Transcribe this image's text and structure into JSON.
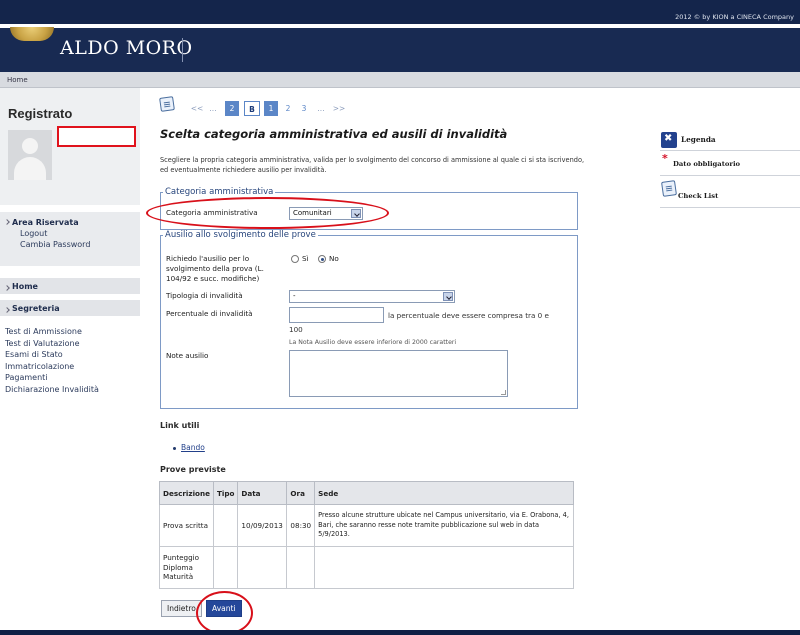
{
  "header": {
    "copyright": "2012 © by KION a CINECA Company",
    "logo_text": "ALDO MORO",
    "breadcrumb_home": "Home"
  },
  "sidebar": {
    "title": "Registrato",
    "area_riservata": "Area Riservata",
    "area_links": [
      "Logout",
      "Cambia Password"
    ],
    "home": "Home",
    "segreteria": "Segreteria",
    "segreteria_links": [
      "Test di Ammissione",
      "Test di Valutazione",
      "Esami di Stato",
      "Immatricolazione",
      "Pagamenti",
      "Dichiarazione Invalidità"
    ]
  },
  "pager": {
    "items": [
      "<<",
      "...",
      "2",
      "B",
      "1",
      "2",
      "3",
      "...",
      ">>"
    ]
  },
  "main": {
    "title": "Scelta categoria amministrativa ed ausili di invalidità",
    "intro": "Scegliere la propria categoria amministrativa, valida per lo svolgimento del concorso di ammissione al quale ci si sta iscrivendo, ed eventualmente richiedere ausilio per invalidità.",
    "cat_legend": "Categoria amministrativa",
    "cat_label": "Categoria amministrativa",
    "cat_value": "Comunitari",
    "ausilio_legend": "Ausilio allo svolgimento delle prove",
    "ausilio_question": "Richiedo l'ausilio per lo svolgimento della prova (L. 104/92 e succ. modifiche)",
    "radio_si": "Sì",
    "radio_no": "No",
    "tipologia_label": "Tipologia di invalidità",
    "tipologia_value": "-",
    "percentuale_label": "Percentuale di invalidità",
    "percentuale_hint": "la percentuale deve essere compresa tra 0 e",
    "percentuale_hint_end": "100",
    "note_hint": "La Nota Ausilio deve essere inferiore di 2000 caratteri",
    "note_label": "Note ausilio",
    "link_utili": "Link utili",
    "bando": "Bando",
    "prove_previste": "Prove previste",
    "table_headers": [
      "Descrizione",
      "Tipo",
      "Data",
      "Ora",
      "Sede"
    ],
    "table_rows": [
      {
        "descrizione": "Prova scritta",
        "tipo": "",
        "data": "10/09/2013",
        "ora": "08:30",
        "sede": "Presso alcune strutture ubicate nel Campus universitario, via E. Orabona, 4, Bari, che saranno resse note tramite pubblicazione sul web in data 5/9/2013."
      },
      {
        "descrizione": "Punteggio Diploma Maturità",
        "tipo": "",
        "data": "",
        "ora": "",
        "sede": ""
      }
    ],
    "btn_indietro": "Indietro",
    "btn_avanti": "Avanti"
  },
  "right_panel": {
    "legenda": "Legenda",
    "obbligatorio": "Dato obbligatorio",
    "checklist": "Check List"
  },
  "colors": {
    "header_bg": "#182a52",
    "accent": "#24479a",
    "annotation_red": "#d8101a"
  }
}
